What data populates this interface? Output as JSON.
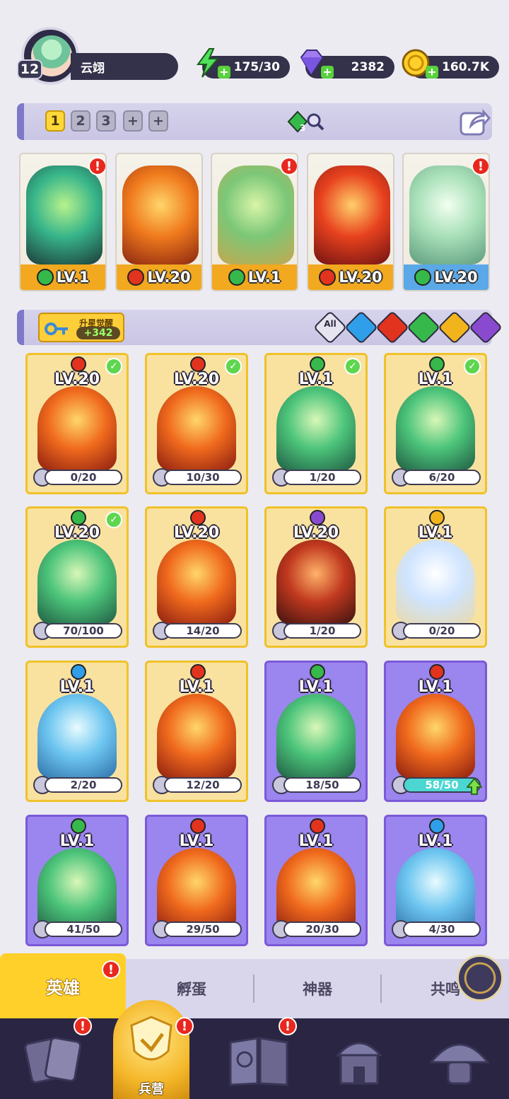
{
  "player": {
    "level": "12",
    "name": "云翊"
  },
  "resources": {
    "energy": "175/30",
    "gems": "2382",
    "gold": "160.7K"
  },
  "team_slots": [
    "1",
    "2",
    "3",
    "+",
    "+"
  ],
  "team_gem_count": "3",
  "team": [
    {
      "level": "LV.1",
      "element": "grass",
      "alert": "!"
    },
    {
      "level": "LV.20",
      "element": "fire",
      "alert": ""
    },
    {
      "level": "LV.1",
      "element": "grass",
      "alert": "!"
    },
    {
      "level": "LV.20",
      "element": "fire",
      "alert": ""
    },
    {
      "level": "LV.20",
      "element": "grass",
      "alert": "!"
    }
  ],
  "filter": {
    "awaken_label": "升星觉醒",
    "awaken_value": "+342",
    "all_label": "All",
    "elements": [
      "water",
      "fire",
      "grass",
      "light",
      "dark"
    ]
  },
  "heroes": [
    {
      "level": "LV.20",
      "progress": "0/20",
      "element": "fire",
      "checked": true,
      "style": "gold"
    },
    {
      "level": "LV.20",
      "progress": "10/30",
      "element": "fire",
      "checked": true,
      "style": "gold"
    },
    {
      "level": "LV.1",
      "progress": "1/20",
      "element": "grass",
      "checked": true,
      "style": "gold"
    },
    {
      "level": "LV.1",
      "progress": "6/20",
      "element": "grass",
      "checked": true,
      "style": "gold"
    },
    {
      "level": "LV.20",
      "progress": "70/100",
      "element": "grass",
      "checked": true,
      "style": "gold"
    },
    {
      "level": "LV.20",
      "progress": "14/20",
      "element": "fire",
      "checked": false,
      "style": "gold"
    },
    {
      "level": "LV.20",
      "progress": "1/20",
      "element": "dark",
      "checked": false,
      "style": "gold"
    },
    {
      "level": "LV.1",
      "progress": "0/20",
      "element": "light",
      "checked": false,
      "style": "gold"
    },
    {
      "level": "LV.1",
      "progress": "2/20",
      "element": "water",
      "checked": false,
      "style": "gold"
    },
    {
      "level": "LV.1",
      "progress": "12/20",
      "element": "fire",
      "checked": false,
      "style": "gold"
    },
    {
      "level": "LV.1",
      "progress": "18/50",
      "element": "grass",
      "checked": false,
      "style": "purple"
    },
    {
      "level": "LV.1",
      "progress": "58/50",
      "element": "fire",
      "checked": false,
      "style": "purple",
      "full": true
    },
    {
      "level": "LV.1",
      "progress": "41/50",
      "element": "grass",
      "checked": false,
      "style": "purple"
    },
    {
      "level": "LV.1",
      "progress": "29/50",
      "element": "fire",
      "checked": false,
      "style": "purple"
    },
    {
      "level": "LV.1",
      "progress": "20/30",
      "element": "fire",
      "checked": false,
      "style": "purple"
    },
    {
      "level": "LV.1",
      "progress": "4/30",
      "element": "water",
      "checked": false,
      "style": "purple"
    }
  ],
  "subtabs": {
    "heroes": "英雄",
    "hatch": "孵蛋",
    "artifact": "神器",
    "resonance": "共鸣"
  },
  "alerts": {
    "heroes_tab": "!",
    "nav_cards": "!",
    "nav_barracks": "!",
    "nav_book": "!"
  },
  "nav": {
    "barracks": "兵营"
  },
  "colors": {
    "grass": "#36b94a",
    "fire": "#e2331f",
    "water": "#2e9fe8",
    "light": "#f2b41c",
    "dark": "#8a4ad0"
  }
}
